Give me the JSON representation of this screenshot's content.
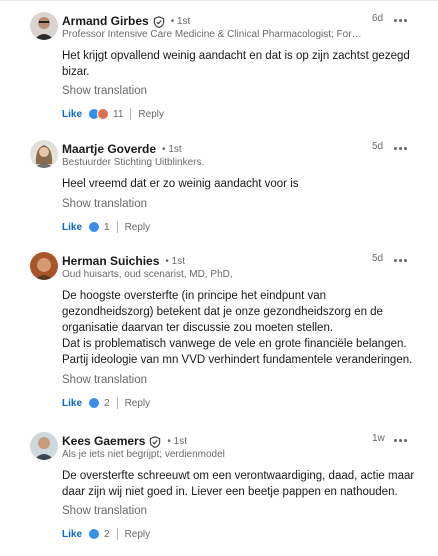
{
  "colors": {
    "brand_blue": "#0a66c2",
    "celebrate_red": "#df704d",
    "bubble": "#f2f2f2"
  },
  "common": {
    "show_translation": "Show translation",
    "like": "Like",
    "reply": "Reply",
    "more_icon": "ellipsis-icon"
  },
  "comments": [
    {
      "name": "Armand Girbes",
      "verified": true,
      "degree": "• 1st",
      "headline": "Professor Intensive Care Medicine & Clinical Pharmacologist; Forme...",
      "time": "6d",
      "text": [
        "Het krijgt opvallend weinig aandacht en dat is op zijn zachtst gezegd bizar."
      ],
      "reactions": [
        "like",
        "celebrate"
      ],
      "count": "11"
    },
    {
      "name": "Maartje Goverde",
      "verified": false,
      "degree": "• 1st",
      "headline": "Bestuurder Stichting Uitblinkers.",
      "time": "5d",
      "text": [
        "Heel vreemd dat er zo weinig aandacht voor is"
      ],
      "reactions": [
        "like"
      ],
      "count": "1"
    },
    {
      "name": "Herman Suichies",
      "verified": false,
      "degree": "• 1st",
      "headline": "Oud huisarts, oud scenarist, MD, PhD,",
      "time": "5d",
      "text": [
        "De hoogste oversterfte (in principe het eindpunt van gezondheidszorg) betekent dat je onze gezondheidszorg en de organisatie daarvan ter discussie zou moeten stellen.",
        "Dat is problematisch vanwege de vele en grote financiële belangen.",
        "Partij ideologie van mn VVD verhindert fundamentele veranderingen."
      ],
      "reactions": [
        "like"
      ],
      "count": "2"
    },
    {
      "name": "Kees Gaemers",
      "verified": true,
      "degree": "• 1st",
      "headline": "Als je iets niet begrijpt; verdienmodel",
      "time": "1w",
      "text": [
        "De oversterfte schreeuwt om een verontwaardiging, daad, actie maar daar zijn wij niet goed in. Liever een beetje pappen en nathouden."
      ],
      "reactions": [
        "like"
      ],
      "count": "2"
    }
  ]
}
